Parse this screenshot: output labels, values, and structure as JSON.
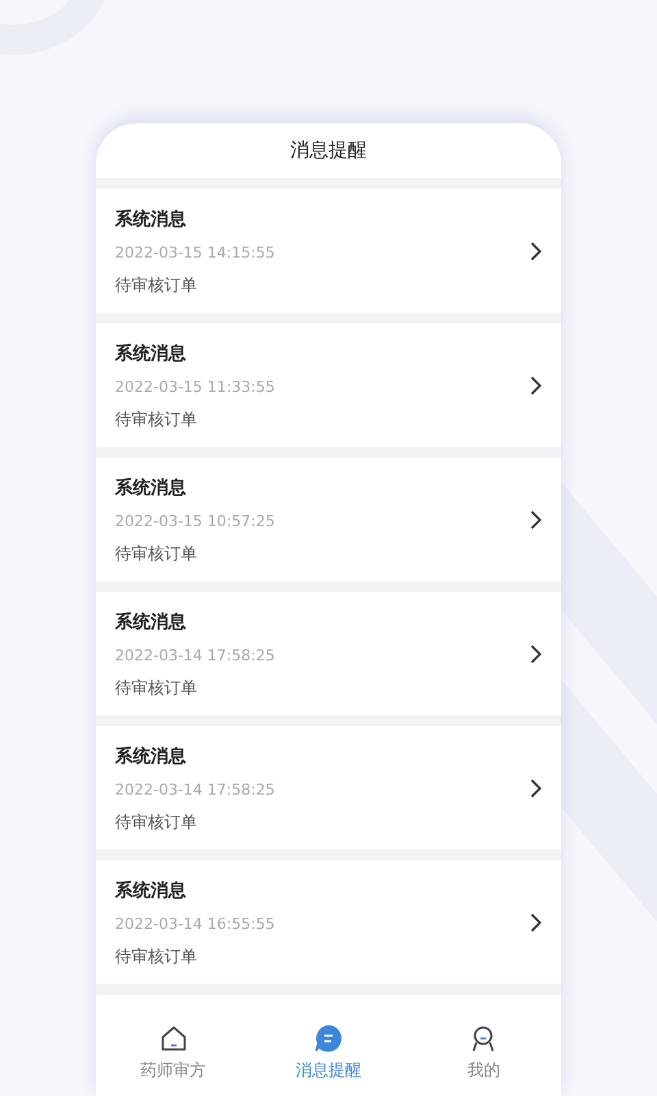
{
  "header": {
    "title": "消息提醒"
  },
  "messages": [
    {
      "title": "系统消息",
      "time": "2022-03-15 14:15:55",
      "text": "待审核订单"
    },
    {
      "title": "系统消息",
      "time": "2022-03-15 11:33:55",
      "text": "待审核订单"
    },
    {
      "title": "系统消息",
      "time": "2022-03-15 10:57:25",
      "text": "待审核订单"
    },
    {
      "title": "系统消息",
      "time": "2022-03-14 17:58:25",
      "text": "待审核订单"
    },
    {
      "title": "系统消息",
      "time": "2022-03-14 17:58:25",
      "text": "待审核订单"
    },
    {
      "title": "系统消息",
      "time": "2022-03-14 16:55:55",
      "text": "待审核订单"
    }
  ],
  "tab_bar": [
    {
      "label": "药师审方",
      "selected": false
    },
    {
      "label": "消息提醒",
      "selected": true
    },
    {
      "label": "我的",
      "selected": false
    }
  ]
}
